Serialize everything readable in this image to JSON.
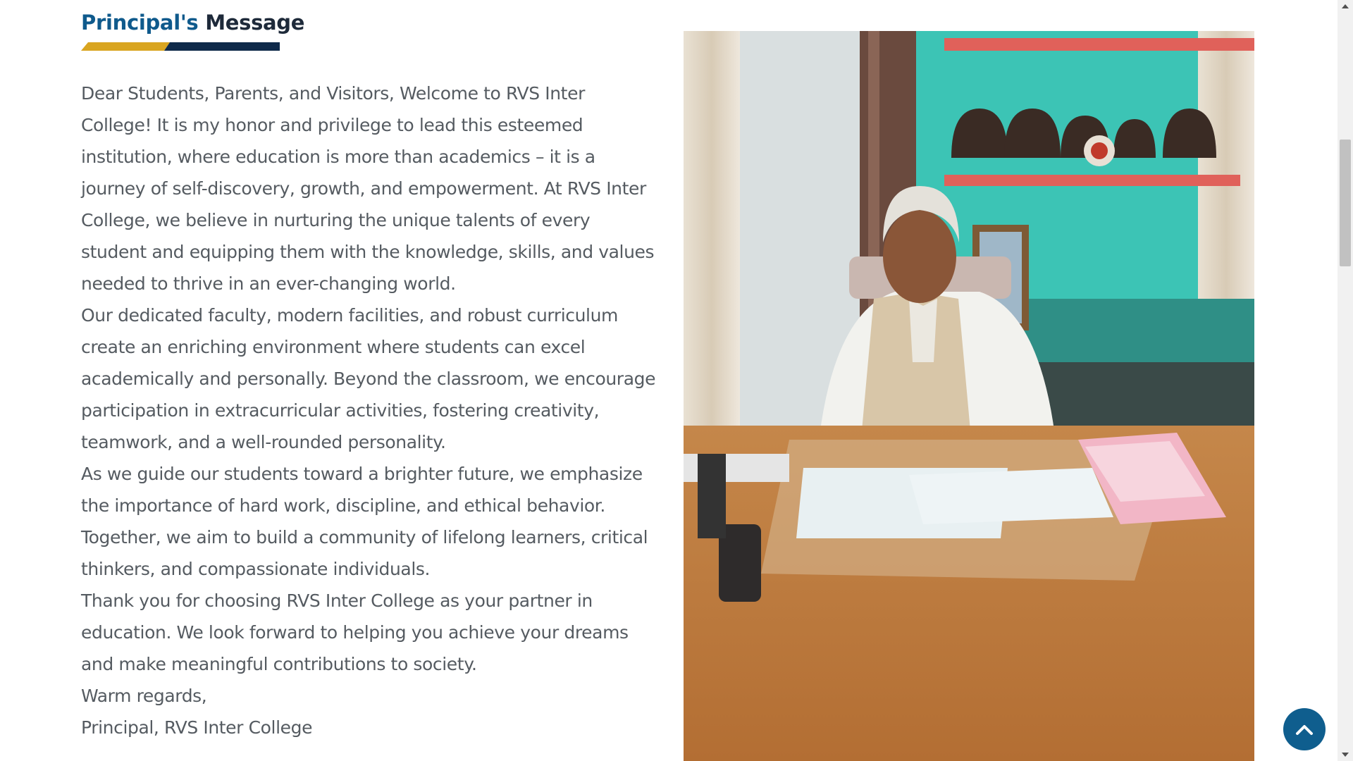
{
  "section": {
    "title_accent": "Principal's",
    "title_rest": "Message",
    "accent_colors": {
      "gold": "#d9a520",
      "navy": "#0f2a4a",
      "blue": "#0f5a8c"
    }
  },
  "message": {
    "paragraphs": [
      "Dear Students, Parents, and Visitors, Welcome to RVS Inter College! It is my honor and privilege to lead this esteemed institution, where education is more than academics – it is a journey of self-discovery, growth, and empowerment. At RVS Inter College, we believe in nurturing the unique talents of every student and equipping them with the knowledge, skills, and values needed to thrive in an ever-changing world.",
      "Our dedicated faculty, modern facilities, and robust curriculum create an enriching environment where students can excel academically and personally. Beyond the classroom, we encourage participation in extracurricular activities, fostering creativity, teamwork, and a well-rounded personality.",
      "As we guide our students toward a brighter future, we emphasize the importance of hard work, discipline, and ethical behavior. Together, we aim to build a community of lifelong learners, critical thinkers, and compassionate individuals.",
      "Thank you for choosing RVS Inter College as your partner in education. We look forward to helping you achieve your dreams and make meaningful contributions to society.",
      "Warm regards,",
      "Principal, RVS Inter College"
    ]
  },
  "photo": {
    "icon": "principal-photo"
  },
  "scroll_top": {
    "icon": "chevron-up-icon",
    "color": "#0f5e8e"
  }
}
